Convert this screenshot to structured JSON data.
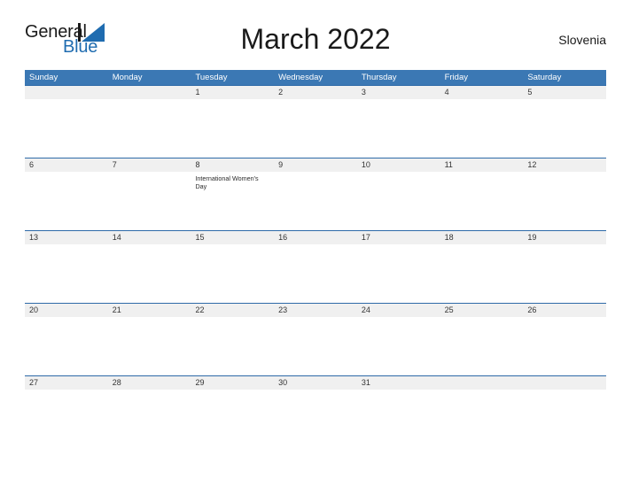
{
  "brand": {
    "name_part1": "General",
    "name_part2": "Blue",
    "mark_icon": "triangle-flag-icon",
    "accent_color": "#1f6cb0"
  },
  "header": {
    "title": "March 2022",
    "country": "Slovenia"
  },
  "colors": {
    "header_blue": "#3b78b4",
    "row_divider_blue": "#2e6aa8",
    "band_gray": "#f0f0f0",
    "text_dark": "#1a1a1a"
  },
  "calendar": {
    "weekday_headers": [
      "Sunday",
      "Monday",
      "Tuesday",
      "Wednesday",
      "Thursday",
      "Friday",
      "Saturday"
    ],
    "weeks": [
      {
        "days": [
          {
            "num": "",
            "event": ""
          },
          {
            "num": "",
            "event": ""
          },
          {
            "num": "1",
            "event": ""
          },
          {
            "num": "2",
            "event": ""
          },
          {
            "num": "3",
            "event": ""
          },
          {
            "num": "4",
            "event": ""
          },
          {
            "num": "5",
            "event": ""
          }
        ]
      },
      {
        "days": [
          {
            "num": "6",
            "event": ""
          },
          {
            "num": "7",
            "event": ""
          },
          {
            "num": "8",
            "event": "International Women's Day"
          },
          {
            "num": "9",
            "event": ""
          },
          {
            "num": "10",
            "event": ""
          },
          {
            "num": "11",
            "event": ""
          },
          {
            "num": "12",
            "event": ""
          }
        ]
      },
      {
        "days": [
          {
            "num": "13",
            "event": ""
          },
          {
            "num": "14",
            "event": ""
          },
          {
            "num": "15",
            "event": ""
          },
          {
            "num": "16",
            "event": ""
          },
          {
            "num": "17",
            "event": ""
          },
          {
            "num": "18",
            "event": ""
          },
          {
            "num": "19",
            "event": ""
          }
        ]
      },
      {
        "days": [
          {
            "num": "20",
            "event": ""
          },
          {
            "num": "21",
            "event": ""
          },
          {
            "num": "22",
            "event": ""
          },
          {
            "num": "23",
            "event": ""
          },
          {
            "num": "24",
            "event": ""
          },
          {
            "num": "25",
            "event": ""
          },
          {
            "num": "26",
            "event": ""
          }
        ]
      },
      {
        "days": [
          {
            "num": "27",
            "event": ""
          },
          {
            "num": "28",
            "event": ""
          },
          {
            "num": "29",
            "event": ""
          },
          {
            "num": "30",
            "event": ""
          },
          {
            "num": "31",
            "event": ""
          },
          {
            "num": "",
            "event": ""
          },
          {
            "num": "",
            "event": ""
          }
        ]
      }
    ]
  }
}
